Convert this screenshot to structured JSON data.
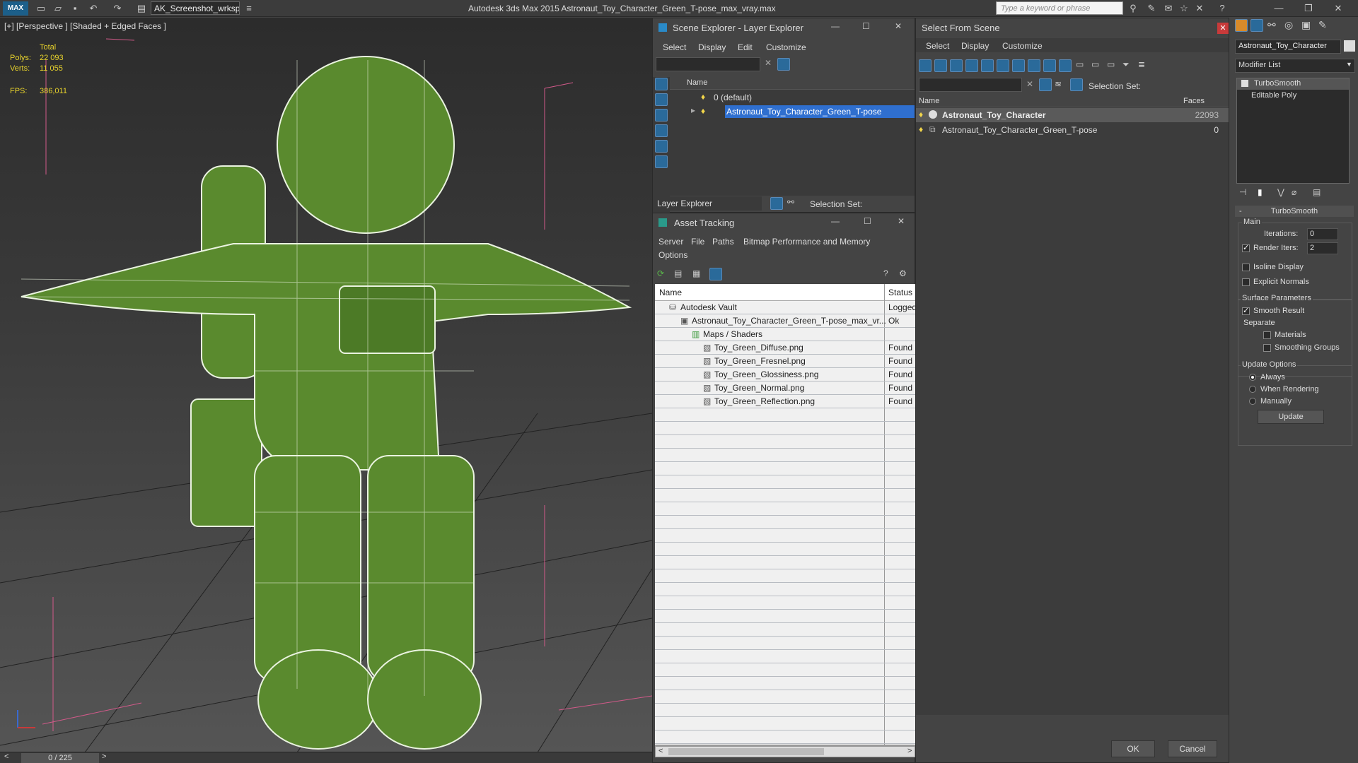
{
  "titlebar": {
    "logo": "MAX",
    "workspace": "AK_Screenshot_wrksp",
    "app_title": "Autodesk 3ds Max  2015     Astronaut_Toy_Character_Green_T-pose_max_vray.max",
    "search_placeholder": "Type a keyword or phrase"
  },
  "viewport": {
    "label": "[+] [Perspective ] [Shaded + Edged Faces ]",
    "stats_header": "Total",
    "polys_label": "Polys:",
    "polys_value": "22 093",
    "verts_label": "Verts:",
    "verts_value": "11 055",
    "fps_label": "FPS:",
    "fps_value": "386,011",
    "frame_counter": "0 / 225",
    "model_color": "#5a8a2e"
  },
  "scene_explorer": {
    "title": "Scene Explorer - Layer Explorer",
    "menu": [
      "Select",
      "Display",
      "Edit",
      "Customize"
    ],
    "column": "Name",
    "layers": [
      "0 (default)",
      "Astronaut_Toy_Character_Green_T-pose"
    ],
    "footer_label": "Layer Explorer",
    "selection_set": "Selection Set:"
  },
  "asset_tracking": {
    "title": "Asset Tracking",
    "menu": [
      "Server",
      "File",
      "Paths",
      "Bitmap Performance and Memory"
    ],
    "menu2": "Options",
    "col_name": "Name",
    "col_status": "Status",
    "rows": [
      {
        "name": "Autodesk Vault",
        "status": "Logged",
        "indent": 0
      },
      {
        "name": "Astronaut_Toy_Character_Green_T-pose_max_vr...",
        "status": "Ok",
        "indent": 1
      },
      {
        "name": "Maps / Shaders",
        "status": "",
        "indent": 2
      },
      {
        "name": "Toy_Green_Diffuse.png",
        "status": "Found",
        "indent": 3
      },
      {
        "name": "Toy_Green_Fresnel.png",
        "status": "Found",
        "indent": 3
      },
      {
        "name": "Toy_Green_Glossiness.png",
        "status": "Found",
        "indent": 3
      },
      {
        "name": "Toy_Green_Normal.png",
        "status": "Found",
        "indent": 3
      },
      {
        "name": "Toy_Green_Reflection.png",
        "status": "Found",
        "indent": 3
      }
    ]
  },
  "select_from_scene": {
    "title": "Select From Scene",
    "menu": [
      "Select",
      "Display",
      "Customize"
    ],
    "selection_set": "Selection Set:",
    "col_name": "Name",
    "col_faces": "Faces",
    "rows": [
      {
        "name": "Astronaut_Toy_Character",
        "faces": "22093"
      },
      {
        "name": "Astronaut_Toy_Character_Green_T-pose",
        "faces": "0"
      }
    ],
    "ok": "OK",
    "cancel": "Cancel"
  },
  "command_panel": {
    "object_name": "Astronaut_Toy_Character",
    "modifier_list": "Modifier List",
    "stack": [
      "TurboSmooth",
      "Editable Poly"
    ],
    "rollout": "TurboSmooth",
    "main": "Main",
    "iterations_label": "Iterations:",
    "iterations": "0",
    "render_iters_label": "Render Iters:",
    "render_iters": "2",
    "isoline": "Isoline Display",
    "explicit_normals": "Explicit Normals",
    "surface_params": "Surface Parameters",
    "smooth_result": "Smooth Result",
    "separate": "Separate",
    "materials": "Materials",
    "smoothing_groups": "Smoothing Groups",
    "update_options": "Update Options",
    "always": "Always",
    "when_rendering": "When Rendering",
    "manually": "Manually",
    "update": "Update"
  }
}
